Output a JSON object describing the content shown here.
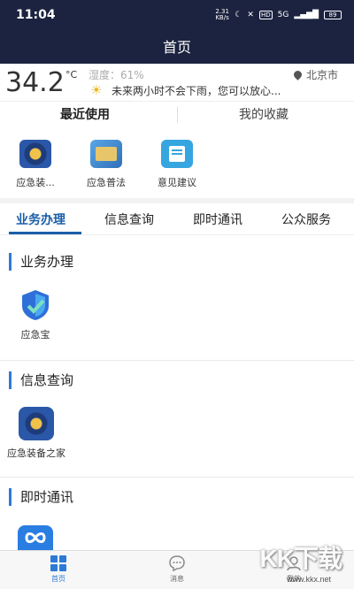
{
  "status_bar": {
    "time": "11:04",
    "net_speed": "2.31\nKB/s",
    "signal": "5G",
    "battery": "89"
  },
  "nav": {
    "title": "首页"
  },
  "weather": {
    "temperature": "34.2",
    "unit": "°C",
    "humidity": "湿度：61%",
    "city": "北京市",
    "forecast": "未来两小时不会下雨，您可以放心..."
  },
  "fav_tabs": {
    "recent": "最近使用",
    "favorites": "我的收藏"
  },
  "quick_items": [
    {
      "label": "应急装...",
      "icon": "emergency-equipment-icon"
    },
    {
      "label": "应急普法",
      "icon": "law-book-icon"
    },
    {
      "label": "意见建议",
      "icon": "feedback-form-icon"
    }
  ],
  "main_tabs": [
    "业务办理",
    "信息查询",
    "即时通讯",
    "公众服务"
  ],
  "sections": [
    {
      "title": "业务办理",
      "items": [
        {
          "label": "应急宝",
          "icon": "shield-check-icon"
        }
      ]
    },
    {
      "title": "信息查询",
      "items": [
        {
          "label": "应急装备之家",
          "icon": "emergency-emblem-icon"
        }
      ]
    },
    {
      "title": "即时通讯",
      "items": [
        {
          "label": "",
          "icon": "chat-infinity-icon"
        }
      ]
    }
  ],
  "bottom_nav": [
    {
      "label": "首页",
      "icon": "home-grid-icon",
      "active": true
    },
    {
      "label": "消息",
      "icon": "message-bubble-icon",
      "active": false
    },
    {
      "label": "我的",
      "icon": "profile-icon",
      "active": false
    }
  ],
  "watermark": {
    "text": "KK下载",
    "url": "www.kkx.net"
  },
  "colors": {
    "header_bg": "#1c2340",
    "accent": "#1b5fa8",
    "section_bar": "#2d7ad6"
  }
}
